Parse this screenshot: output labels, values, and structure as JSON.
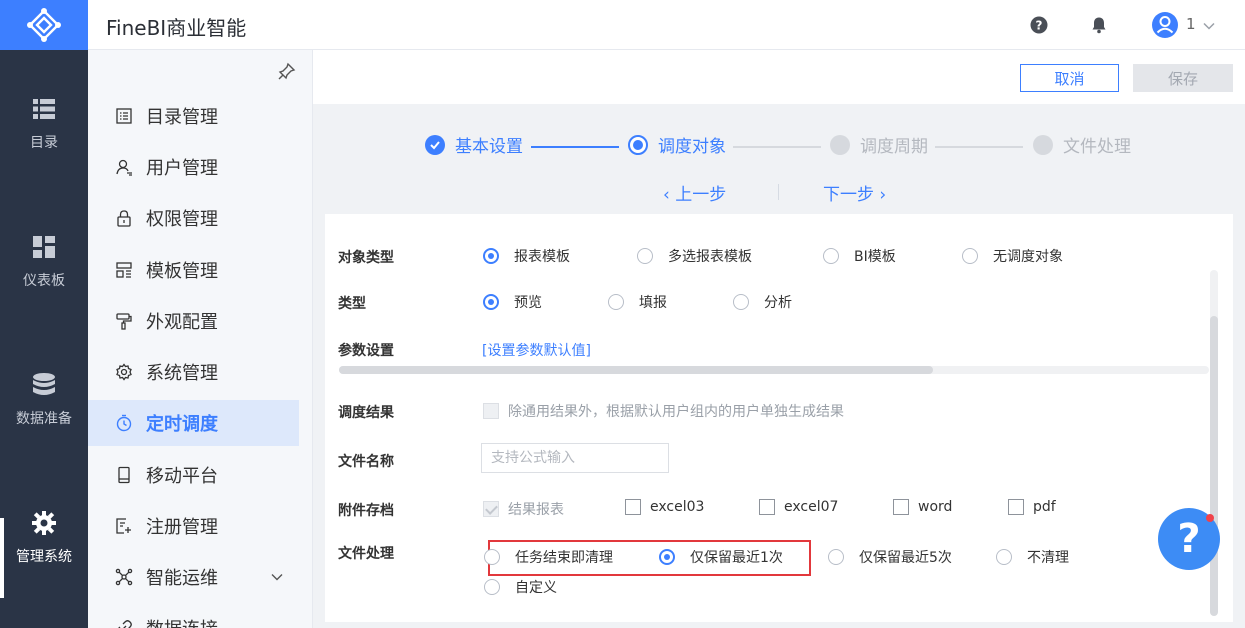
{
  "app": {
    "title": "FineBI商业智能"
  },
  "header": {
    "user_count": "1"
  },
  "rail": {
    "items": [
      {
        "label": "目录",
        "icon": "list-icon"
      },
      {
        "label": "仪表板",
        "icon": "dashboard-icon"
      },
      {
        "label": "数据准备",
        "icon": "database-icon"
      },
      {
        "label": "管理系统",
        "icon": "gear-icon",
        "active": true
      }
    ]
  },
  "sidebar": {
    "items": [
      {
        "label": "目录管理",
        "icon": "catalog-icon"
      },
      {
        "label": "用户管理",
        "icon": "user-icon"
      },
      {
        "label": "权限管理",
        "icon": "lock-icon"
      },
      {
        "label": "模板管理",
        "icon": "template-icon"
      },
      {
        "label": "外观配置",
        "icon": "paint-roller-icon"
      },
      {
        "label": "系统管理",
        "icon": "settings-icon"
      },
      {
        "label": "定时调度",
        "icon": "timer-icon",
        "active": true
      },
      {
        "label": "移动平台",
        "icon": "mobile-icon"
      },
      {
        "label": "注册管理",
        "icon": "register-icon"
      },
      {
        "label": "智能运维",
        "icon": "network-icon"
      },
      {
        "label": "数据连接",
        "icon": "link-icon"
      }
    ]
  },
  "toolbar": {
    "cancel_label": "取消",
    "save_label": "保存"
  },
  "steps": [
    {
      "label": "基本设置",
      "state": "done"
    },
    {
      "label": "调度对象",
      "state": "current"
    },
    {
      "label": "调度周期",
      "state": "pending"
    },
    {
      "label": "文件处理",
      "state": "pending"
    }
  ],
  "nav": {
    "prev_label": "上一步",
    "next_label": "下一步"
  },
  "form": {
    "object_type": {
      "label": "对象类型",
      "options": [
        "报表模板",
        "多选报表模板",
        "BI模板",
        "无调度对象"
      ],
      "selected": "报表模板"
    },
    "type": {
      "label": "类型",
      "options": [
        "预览",
        "填报",
        "分析"
      ],
      "selected": "预览"
    },
    "params": {
      "label": "参数设置",
      "link": "[设置参数默认值]"
    },
    "result": {
      "label": "调度结果",
      "checkbox_text": "除通用结果外，根据默认用户组内的用户单独生成结果"
    },
    "filename": {
      "label": "文件名称",
      "placeholder": "支持公式输入",
      "value": ""
    },
    "attachment": {
      "label": "附件存档",
      "options": [
        "结果报表",
        "excel03",
        "excel07",
        "word",
        "pdf"
      ]
    },
    "file_handling": {
      "label": "文件处理",
      "options": [
        "任务结束即清理",
        "仅保留最近1次",
        "仅保留最近5次",
        "不清理",
        "自定义"
      ],
      "selected": "仅保留最近1次"
    }
  },
  "colors": {
    "accent": "#3d7fff",
    "rail_bg": "#2a3446",
    "highlight": "#e2383c"
  }
}
